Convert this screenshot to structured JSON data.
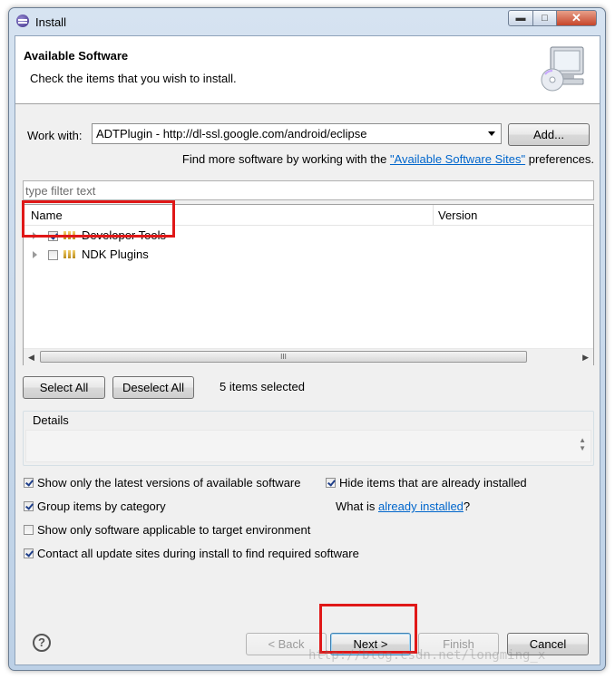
{
  "window": {
    "title": "Install",
    "controls": {
      "minimize": "▬",
      "maximize": "□",
      "close": "✕"
    }
  },
  "header": {
    "title": "Available Software",
    "description": "Check the items that you wish to install."
  },
  "work_with": {
    "label": "Work with:",
    "value": "ADTPlugin - http://dl-ssl.google.com/android/eclipse",
    "add_button": "Add..."
  },
  "find_more": {
    "prefix": "Find more software by working with the ",
    "link": "\"Available Software Sites\"",
    "suffix": " preferences."
  },
  "filter": {
    "placeholder": "type filter text"
  },
  "tree": {
    "columns": {
      "name": "Name",
      "version": "Version"
    },
    "items": [
      {
        "label": "Developer Tools",
        "checked": true
      },
      {
        "label": "NDK Plugins",
        "checked": false
      }
    ],
    "scroll_grip": "III"
  },
  "selection": {
    "select_all": "Select All",
    "deselect_all": "Deselect All",
    "count_text": "5 items selected"
  },
  "details": {
    "label": "Details"
  },
  "options": {
    "show_latest": {
      "label": "Show only the latest versions of available software",
      "checked": true
    },
    "hide_installed": {
      "label": "Hide items that are already installed",
      "checked": true
    },
    "group_by_category": {
      "label": "Group items by category",
      "checked": true
    },
    "what_is_prefix": "What is ",
    "what_is_link": "already installed",
    "what_is_suffix": "?",
    "target_env": {
      "label": "Show only software applicable to target environment",
      "checked": false
    },
    "contact_sites": {
      "label": "Contact all update sites during install to find required software",
      "checked": true
    }
  },
  "footer": {
    "help": "?",
    "back": "< Back",
    "next": "Next >",
    "finish": "Finish",
    "cancel": "Cancel"
  },
  "watermark": "http://blog.csdn.net/longming_x"
}
